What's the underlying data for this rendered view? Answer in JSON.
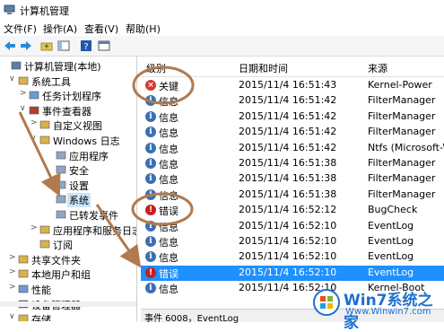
{
  "window": {
    "title": "计算机管理"
  },
  "menu": [
    "文件(F)",
    "操作(A)",
    "查看(V)",
    "帮助(H)"
  ],
  "toolbar": [
    "back-icon",
    "forward-icon",
    "folder-up-icon",
    "show-hide-tree-icon",
    "help-icon",
    "properties-icon"
  ],
  "tree": [
    {
      "label": "计算机管理(本地)",
      "icon": "computer-management-icon",
      "twisty": ""
    },
    {
      "label": "系统工具",
      "icon": "tools-icon",
      "twisty": "∨"
    },
    {
      "label": "任务计划程序",
      "icon": "clock-icon",
      "twisty": ">"
    },
    {
      "label": "事件查看器",
      "icon": "event-viewer-icon",
      "twisty": "∨"
    },
    {
      "label": "自定义视图",
      "icon": "folder-icon",
      "twisty": ">"
    },
    {
      "label": "Windows 日志",
      "icon": "folder-icon",
      "twisty": "∨"
    },
    {
      "label": "应用程序",
      "icon": "log-icon",
      "twisty": ""
    },
    {
      "label": "安全",
      "icon": "log-icon",
      "twisty": ""
    },
    {
      "label": "设置",
      "icon": "log-icon",
      "twisty": ""
    },
    {
      "label": "系统",
      "icon": "log-icon",
      "twisty": ""
    },
    {
      "label": "已转发事件",
      "icon": "log-icon",
      "twisty": ""
    },
    {
      "label": "应用程序和服务日志",
      "icon": "folder-icon",
      "twisty": ">"
    },
    {
      "label": "订阅",
      "icon": "subscription-icon",
      "twisty": ""
    },
    {
      "label": "共享文件夹",
      "icon": "shared-folder-icon",
      "twisty": ">"
    },
    {
      "label": "本地用户和组",
      "icon": "users-icon",
      "twisty": ">"
    },
    {
      "label": "性能",
      "icon": "performance-icon",
      "twisty": ">"
    },
    {
      "label": "设备管理器",
      "icon": "device-manager-icon",
      "twisty": ""
    },
    {
      "label": "存储",
      "icon": "storage-icon",
      "twisty": "∨"
    }
  ],
  "list": {
    "headers": {
      "level": "级别",
      "datetime": "日期和时间",
      "source": "来源"
    },
    "rows": [
      {
        "type": "crit",
        "level": "关键",
        "datetime": "2015/11/4 16:51:43",
        "source": "Kernel-Power"
      },
      {
        "type": "info",
        "level": "信息",
        "datetime": "2015/11/4 16:51:42",
        "source": "FilterManager"
      },
      {
        "type": "info",
        "level": "信息",
        "datetime": "2015/11/4 16:51:42",
        "source": "FilterManager"
      },
      {
        "type": "info",
        "level": "信息",
        "datetime": "2015/11/4 16:51:42",
        "source": "FilterManager"
      },
      {
        "type": "info",
        "level": "信息",
        "datetime": "2015/11/4 16:51:42",
        "source": "Ntfs (Microsoft-W"
      },
      {
        "type": "info",
        "level": "信息",
        "datetime": "2015/11/4 16:51:38",
        "source": "FilterManager"
      },
      {
        "type": "info",
        "level": "信息",
        "datetime": "2015/11/4 16:51:38",
        "source": "FilterManager"
      },
      {
        "type": "info",
        "level": "信息",
        "datetime": "2015/11/4 16:51:38",
        "source": "FilterManager"
      },
      {
        "type": "err",
        "level": "错误",
        "datetime": "2015/11/4 16:52:12",
        "source": "BugCheck"
      },
      {
        "type": "info",
        "level": "信息",
        "datetime": "2015/11/4 16:52:10",
        "source": "EventLog"
      },
      {
        "type": "info",
        "level": "信息",
        "datetime": "2015/11/4 16:52:10",
        "source": "EventLog"
      },
      {
        "type": "info",
        "level": "信息",
        "datetime": "2015/11/4 16:52:10",
        "source": "EventLog"
      },
      {
        "type": "err",
        "level": "错误",
        "datetime": "2015/11/4 16:52:10",
        "source": "EventLog"
      },
      {
        "type": "info",
        "level": "信息",
        "datetime": "2015/11/4 16:52:10",
        "source": "Kernel-Boot"
      }
    ],
    "selected_index": 12
  },
  "status": "事件 6008，EventLog",
  "watermark": {
    "brand": "Win7系统之家",
    "url": "Www.Winwin7.com"
  },
  "colors": {
    "selection": "#1e90ff",
    "annotation": "#b07a4e",
    "info_icon": "#3a6fb5",
    "error_icon": "#c81e1e"
  }
}
